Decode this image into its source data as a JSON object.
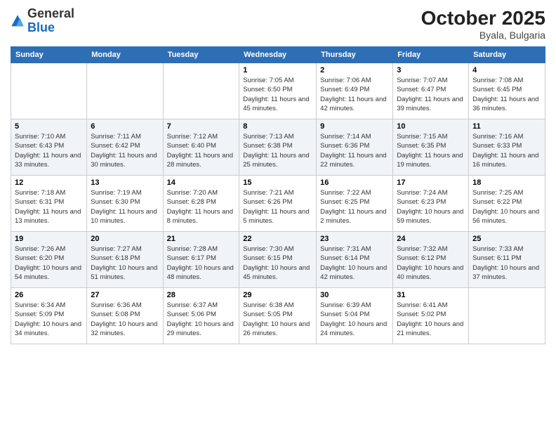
{
  "header": {
    "logo_general": "General",
    "logo_blue": "Blue",
    "month_title": "October 2025",
    "location": "Byala, Bulgaria"
  },
  "days_of_week": [
    "Sunday",
    "Monday",
    "Tuesday",
    "Wednesday",
    "Thursday",
    "Friday",
    "Saturday"
  ],
  "weeks": [
    [
      {
        "day": "",
        "info": ""
      },
      {
        "day": "",
        "info": ""
      },
      {
        "day": "",
        "info": ""
      },
      {
        "day": "1",
        "info": "Sunrise: 7:05 AM\nSunset: 6:50 PM\nDaylight: 11 hours and 45 minutes."
      },
      {
        "day": "2",
        "info": "Sunrise: 7:06 AM\nSunset: 6:49 PM\nDaylight: 11 hours and 42 minutes."
      },
      {
        "day": "3",
        "info": "Sunrise: 7:07 AM\nSunset: 6:47 PM\nDaylight: 11 hours and 39 minutes."
      },
      {
        "day": "4",
        "info": "Sunrise: 7:08 AM\nSunset: 6:45 PM\nDaylight: 11 hours and 36 minutes."
      }
    ],
    [
      {
        "day": "5",
        "info": "Sunrise: 7:10 AM\nSunset: 6:43 PM\nDaylight: 11 hours and 33 minutes."
      },
      {
        "day": "6",
        "info": "Sunrise: 7:11 AM\nSunset: 6:42 PM\nDaylight: 11 hours and 30 minutes."
      },
      {
        "day": "7",
        "info": "Sunrise: 7:12 AM\nSunset: 6:40 PM\nDaylight: 11 hours and 28 minutes."
      },
      {
        "day": "8",
        "info": "Sunrise: 7:13 AM\nSunset: 6:38 PM\nDaylight: 11 hours and 25 minutes."
      },
      {
        "day": "9",
        "info": "Sunrise: 7:14 AM\nSunset: 6:36 PM\nDaylight: 11 hours and 22 minutes."
      },
      {
        "day": "10",
        "info": "Sunrise: 7:15 AM\nSunset: 6:35 PM\nDaylight: 11 hours and 19 minutes."
      },
      {
        "day": "11",
        "info": "Sunrise: 7:16 AM\nSunset: 6:33 PM\nDaylight: 11 hours and 16 minutes."
      }
    ],
    [
      {
        "day": "12",
        "info": "Sunrise: 7:18 AM\nSunset: 6:31 PM\nDaylight: 11 hours and 13 minutes."
      },
      {
        "day": "13",
        "info": "Sunrise: 7:19 AM\nSunset: 6:30 PM\nDaylight: 11 hours and 10 minutes."
      },
      {
        "day": "14",
        "info": "Sunrise: 7:20 AM\nSunset: 6:28 PM\nDaylight: 11 hours and 8 minutes."
      },
      {
        "day": "15",
        "info": "Sunrise: 7:21 AM\nSunset: 6:26 PM\nDaylight: 11 hours and 5 minutes."
      },
      {
        "day": "16",
        "info": "Sunrise: 7:22 AM\nSunset: 6:25 PM\nDaylight: 11 hours and 2 minutes."
      },
      {
        "day": "17",
        "info": "Sunrise: 7:24 AM\nSunset: 6:23 PM\nDaylight: 10 hours and 59 minutes."
      },
      {
        "day": "18",
        "info": "Sunrise: 7:25 AM\nSunset: 6:22 PM\nDaylight: 10 hours and 56 minutes."
      }
    ],
    [
      {
        "day": "19",
        "info": "Sunrise: 7:26 AM\nSunset: 6:20 PM\nDaylight: 10 hours and 54 minutes."
      },
      {
        "day": "20",
        "info": "Sunrise: 7:27 AM\nSunset: 6:18 PM\nDaylight: 10 hours and 51 minutes."
      },
      {
        "day": "21",
        "info": "Sunrise: 7:28 AM\nSunset: 6:17 PM\nDaylight: 10 hours and 48 minutes."
      },
      {
        "day": "22",
        "info": "Sunrise: 7:30 AM\nSunset: 6:15 PM\nDaylight: 10 hours and 45 minutes."
      },
      {
        "day": "23",
        "info": "Sunrise: 7:31 AM\nSunset: 6:14 PM\nDaylight: 10 hours and 42 minutes."
      },
      {
        "day": "24",
        "info": "Sunrise: 7:32 AM\nSunset: 6:12 PM\nDaylight: 10 hours and 40 minutes."
      },
      {
        "day": "25",
        "info": "Sunrise: 7:33 AM\nSunset: 6:11 PM\nDaylight: 10 hours and 37 minutes."
      }
    ],
    [
      {
        "day": "26",
        "info": "Sunrise: 6:34 AM\nSunset: 5:09 PM\nDaylight: 10 hours and 34 minutes."
      },
      {
        "day": "27",
        "info": "Sunrise: 6:36 AM\nSunset: 5:08 PM\nDaylight: 10 hours and 32 minutes."
      },
      {
        "day": "28",
        "info": "Sunrise: 6:37 AM\nSunset: 5:06 PM\nDaylight: 10 hours and 29 minutes."
      },
      {
        "day": "29",
        "info": "Sunrise: 6:38 AM\nSunset: 5:05 PM\nDaylight: 10 hours and 26 minutes."
      },
      {
        "day": "30",
        "info": "Sunrise: 6:39 AM\nSunset: 5:04 PM\nDaylight: 10 hours and 24 minutes."
      },
      {
        "day": "31",
        "info": "Sunrise: 6:41 AM\nSunset: 5:02 PM\nDaylight: 10 hours and 21 minutes."
      },
      {
        "day": "",
        "info": ""
      }
    ]
  ]
}
